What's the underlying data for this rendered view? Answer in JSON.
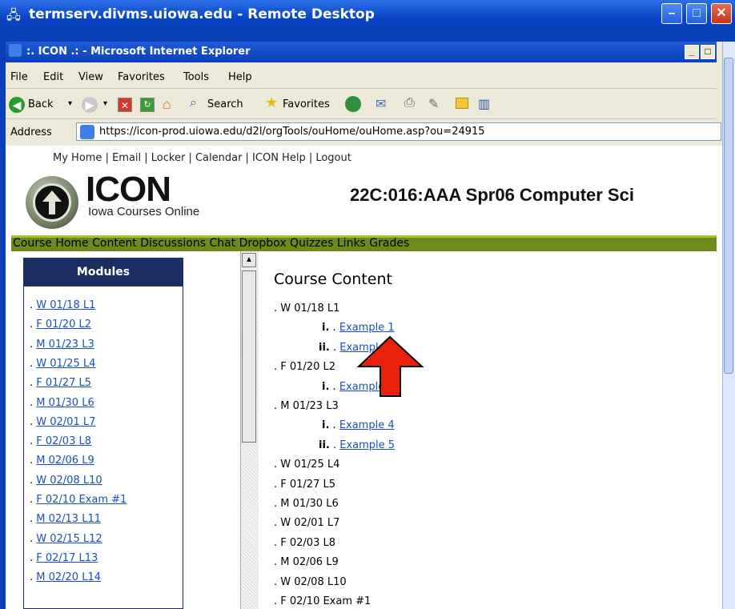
{
  "remote_desktop": {
    "title": "termserv.divms.uiowa.edu - Remote Desktop",
    "min": "–",
    "max": "□",
    "close": "✕"
  },
  "browser": {
    "title": ":. ICON .: - Microsoft Internet Explorer",
    "menu": [
      "File",
      "Edit",
      "View",
      "Favorites",
      "Tools",
      "Help"
    ],
    "toolbar": {
      "back": "Back",
      "search": "Search",
      "favorites": "Favorites"
    },
    "address_label": "Address",
    "address": "https://icon-prod.uiowa.edu/d2l/orgTools/ouHome/ouHome.asp?ou=24915"
  },
  "page": {
    "toplinks": "My Home | Email | Locker | Calendar | ICON Help | Logout",
    "logo_title": "ICON",
    "logo_subtitle": "Iowa Courses Online",
    "course_title": "22C:016:AAA Spr06 Computer Sci",
    "navbar": "Course Home Content Discussions Chat Dropbox Quizzes Links Grades",
    "modules_header": "Modules",
    "modules": [
      "W 01/18 L1",
      "F 01/20 L2",
      "M 01/23 L3",
      "W 01/25 L4",
      "F 01/27 L5",
      "M 01/30 L6",
      "W 02/01 L7",
      "F 02/03 L8",
      "M 02/06 L9",
      "W 02/08 L10",
      "F 02/10 Exam #1",
      "M 02/13 L11",
      "W 02/15 L12",
      "F 02/17 L13",
      "M 02/20 L14"
    ],
    "content_title": "Course Content",
    "content": [
      {
        "label": "W 01/18 L1",
        "subs": [
          {
            "num": "i.",
            "text": "Example 1"
          },
          {
            "num": "ii.",
            "text": "Example 2"
          }
        ]
      },
      {
        "label": "F 01/20 L2",
        "subs": [
          {
            "num": "i.",
            "text": "Example 3"
          }
        ]
      },
      {
        "label": "M 01/23 L3",
        "subs": [
          {
            "num": "i.",
            "text": "Example 4"
          },
          {
            "num": "ii.",
            "text": "Example 5"
          }
        ]
      },
      {
        "label": "W 01/25 L4",
        "subs": []
      },
      {
        "label": "F 01/27 L5",
        "subs": []
      },
      {
        "label": "M 01/30 L6",
        "subs": []
      },
      {
        "label": "W 02/01 L7",
        "subs": []
      },
      {
        "label": "F 02/03 L8",
        "subs": []
      },
      {
        "label": "M 02/06 L9",
        "subs": []
      },
      {
        "label": "W 02/08 L10",
        "subs": []
      },
      {
        "label": "F 02/10 Exam #1",
        "subs": []
      }
    ]
  },
  "colors": {
    "xp_blue": "#0a46c8",
    "nav_green": "#6d8a1f",
    "module_head": "#1c2f63",
    "link": "#1a4ec0",
    "arrow": "#e8200c"
  }
}
